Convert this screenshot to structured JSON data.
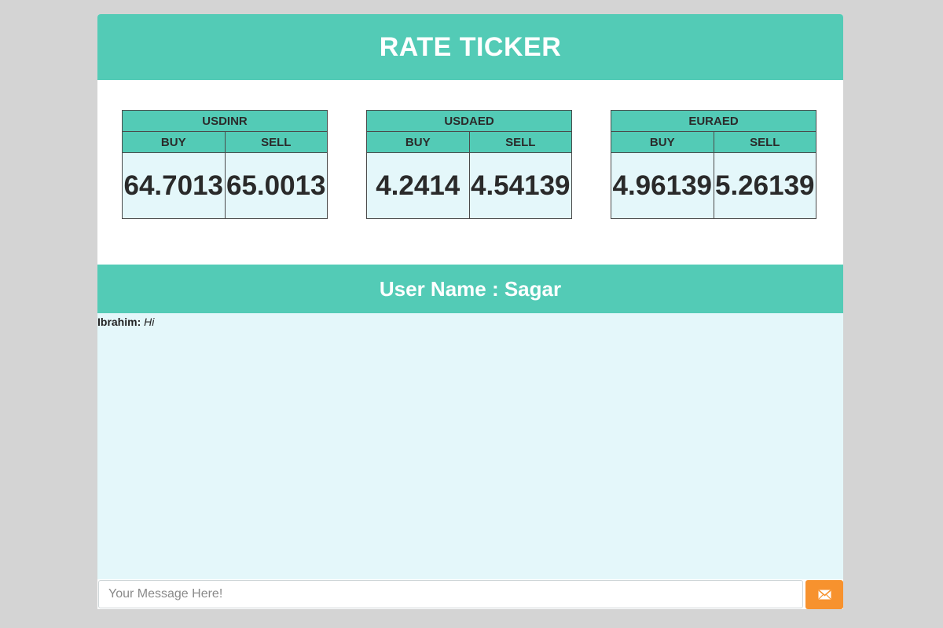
{
  "header": {
    "title": "RATE TICKER"
  },
  "rates": [
    {
      "pair": "USDINR",
      "buy_label": "BUY",
      "sell_label": "SELL",
      "buy": "64.7013",
      "sell": "65.0013"
    },
    {
      "pair": "USDAED",
      "buy_label": "BUY",
      "sell_label": "SELL",
      "buy": "4.2414",
      "sell": "4.54139"
    },
    {
      "pair": "EURAED",
      "buy_label": "BUY",
      "sell_label": "SELL",
      "buy": "4.96139",
      "sell": "5.26139"
    }
  ],
  "user_bar": {
    "text": "User Name : Sagar"
  },
  "chat": {
    "messages": [
      {
        "sender": "Ibrahim:",
        "text": "Hi"
      }
    ]
  },
  "input": {
    "placeholder": "Your Message Here!",
    "value": ""
  },
  "send": {
    "icon": "envelope-icon"
  },
  "colors": {
    "accent": "#53cbb6",
    "chat_bg": "#e4f7fa",
    "send_button": "#f7922e",
    "page_bg": "#d4d4d4"
  }
}
